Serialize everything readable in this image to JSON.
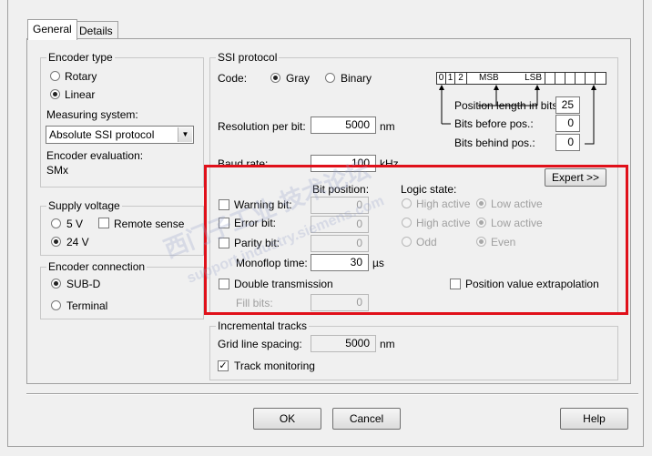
{
  "tabs": [
    {
      "label": "General"
    },
    {
      "label": "Details"
    }
  ],
  "encoder_type": {
    "title": "Encoder type",
    "options": [
      {
        "label": "Rotary",
        "selected": false
      },
      {
        "label": "Linear",
        "selected": true
      }
    ],
    "measuring_label": "Measuring system:",
    "measuring_value": "Absolute SSI protocol",
    "evaluation_label": "Encoder evaluation:",
    "evaluation_value": "SMx"
  },
  "supply_voltage": {
    "title": "Supply voltage",
    "v5": "5 V",
    "v24": "24 V",
    "selected": "24 V",
    "remote_sense": "Remote sense"
  },
  "encoder_connection": {
    "title": "Encoder connection",
    "options": [
      {
        "label": "SUB-D",
        "selected": true
      },
      {
        "label": "Terminal",
        "selected": false
      }
    ]
  },
  "ssi": {
    "title": "SSI protocol",
    "code_label": "Code:",
    "gray": "Gray",
    "binary": "Binary",
    "code_selected": "Gray",
    "resolution_label": "Resolution per bit:",
    "resolution_value": "5000",
    "resolution_unit": "nm",
    "baud_label": "Baud rate:",
    "baud_value": "100",
    "baud_unit": "kHz",
    "bits": {
      "b0": "0",
      "b1": "1",
      "b2": "2",
      "msb": "MSB",
      "lsb": "LSB"
    },
    "pos_len_label": "Position length in bits:",
    "pos_len_value": "25",
    "bits_before_label": "Bits before pos.:",
    "bits_before_value": "0",
    "bits_behind_label": "Bits behind pos.:",
    "bits_behind_value": "0"
  },
  "expert": {
    "button": "Expert >>",
    "bit_position_header": "Bit position:",
    "logic_state_header": "Logic state:",
    "warning_label": "Warning bit:",
    "warning_value": "0",
    "error_label": "Error bit:",
    "error_value": "0",
    "parity_label": "Parity bit:",
    "parity_value": "0",
    "high_active": "High active",
    "low_active": "Low active",
    "odd": "Odd",
    "even": "Even",
    "monoflop_label": "Monoflop time:",
    "monoflop_value": "30",
    "monoflop_unit": "µs",
    "double_label": "Double transmission",
    "fill_label": "Fill bits:",
    "fill_value": "0",
    "extrapolation_label": "Position value extrapolation"
  },
  "incremental": {
    "title": "Incremental tracks",
    "grid_label": "Grid line spacing:",
    "grid_value": "5000",
    "grid_unit": "nm",
    "track_label": "Track monitoring",
    "track_checked": true
  },
  "buttons": {
    "ok": "OK",
    "cancel": "Cancel",
    "help": "Help"
  },
  "watermark": {
    "line1": "西门子工业 技术论坛",
    "line2": "support.industry.siemens.com"
  },
  "colors": {
    "highlight": "#e0101a"
  }
}
